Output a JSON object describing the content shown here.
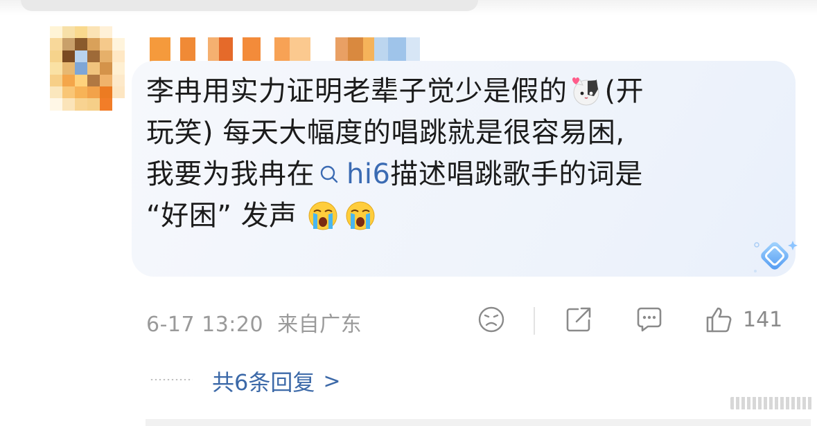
{
  "comment": {
    "text_lines": [
      [
        "李冉用实力证明老辈子觉少是假的",
        "(开"
      ],
      [
        "玩笑) 每天大幅度的唱跳就是很容易困,"
      ],
      [
        "我要为我冉在",
        "描述唱跳歌手的词是"
      ],
      [
        "“好困” 发声"
      ]
    ],
    "topic_label": "hi6",
    "emojis": [
      "cat-emoji",
      "crying-emoji",
      "crying-emoji"
    ]
  },
  "meta": {
    "time": "6-17 13:20",
    "location": "来自广东"
  },
  "actions": {
    "like_count": "141"
  },
  "replies": {
    "label": "共6条回复",
    "chevron": ">"
  },
  "colors": {
    "link_blue": "#3c69a8",
    "meta_gray": "#9a9a9a",
    "bubble_bg": "#f0f4fb"
  }
}
